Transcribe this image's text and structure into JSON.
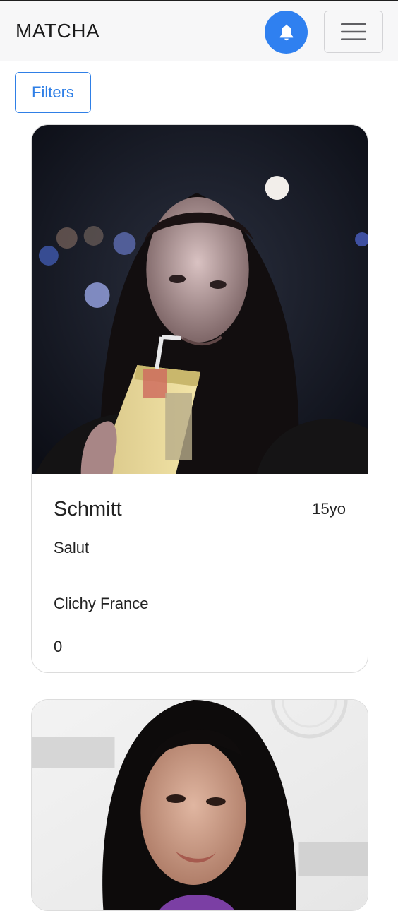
{
  "app": {
    "brand": "MATCHA"
  },
  "navbar": {
    "notification_icon": "bell-icon",
    "menu_icon": "hamburger-menu-icon"
  },
  "filters": {
    "label": "Filters"
  },
  "profiles": [
    {
      "name": "Schmitt",
      "age": "15yo",
      "bio": "Salut",
      "location": "Clichy France",
      "score": "0"
    }
  ],
  "colors": {
    "accent": "#2f80f0",
    "navbar_bg": "#f7f7f8",
    "card_border": "#dcdcdc"
  }
}
